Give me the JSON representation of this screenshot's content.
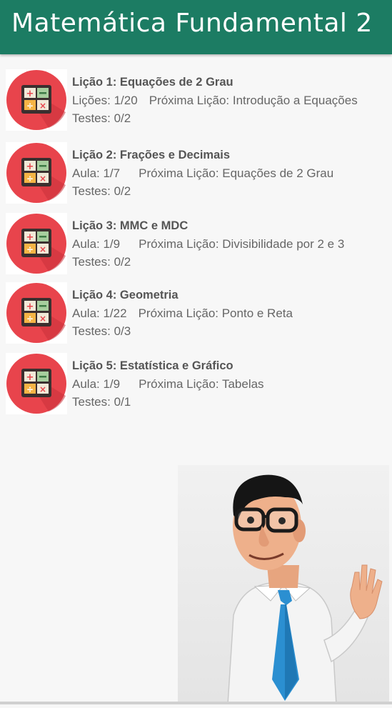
{
  "header": {
    "title": "Matemática Fundamental 2"
  },
  "lessons": [
    {
      "title": "Lição 1: Equações de 2 Grau",
      "progress": "Lições: 1/20",
      "next": "Próxima Lição: Introdução a Equações",
      "tests": "Testes: 0/2"
    },
    {
      "title": "Lição 2: Frações e Decimais",
      "progress": "Aula: 1/7",
      "next": "Próxima Lição: Equações de 2 Grau",
      "tests": "Testes: 0/2"
    },
    {
      "title": "Lição 3: MMC e MDC",
      "progress": "Aula: 1/9",
      "next": "Próxima Lição: Divisibilidade por 2 e 3",
      "tests": "Testes: 0/2"
    },
    {
      "title": "Lição 4: Geometria",
      "progress": "Aula: 1/22",
      "next": "Próxima Lição: Ponto e Reta",
      "tests": "Testes: 0/3"
    },
    {
      "title": "Lição 5: Estatística e Gráfico",
      "progress": "Aula: 1/9",
      "next": "Próxima Lição: Tabelas",
      "tests": "Testes: 0/1"
    }
  ],
  "colors": {
    "appbar": "#1c7c63",
    "icon_circle": "#e8444c",
    "icon_shadow": "#c9323a"
  },
  "icons": {
    "lesson_icon": "calculator-icon",
    "mascot": "teacher-mascot"
  }
}
